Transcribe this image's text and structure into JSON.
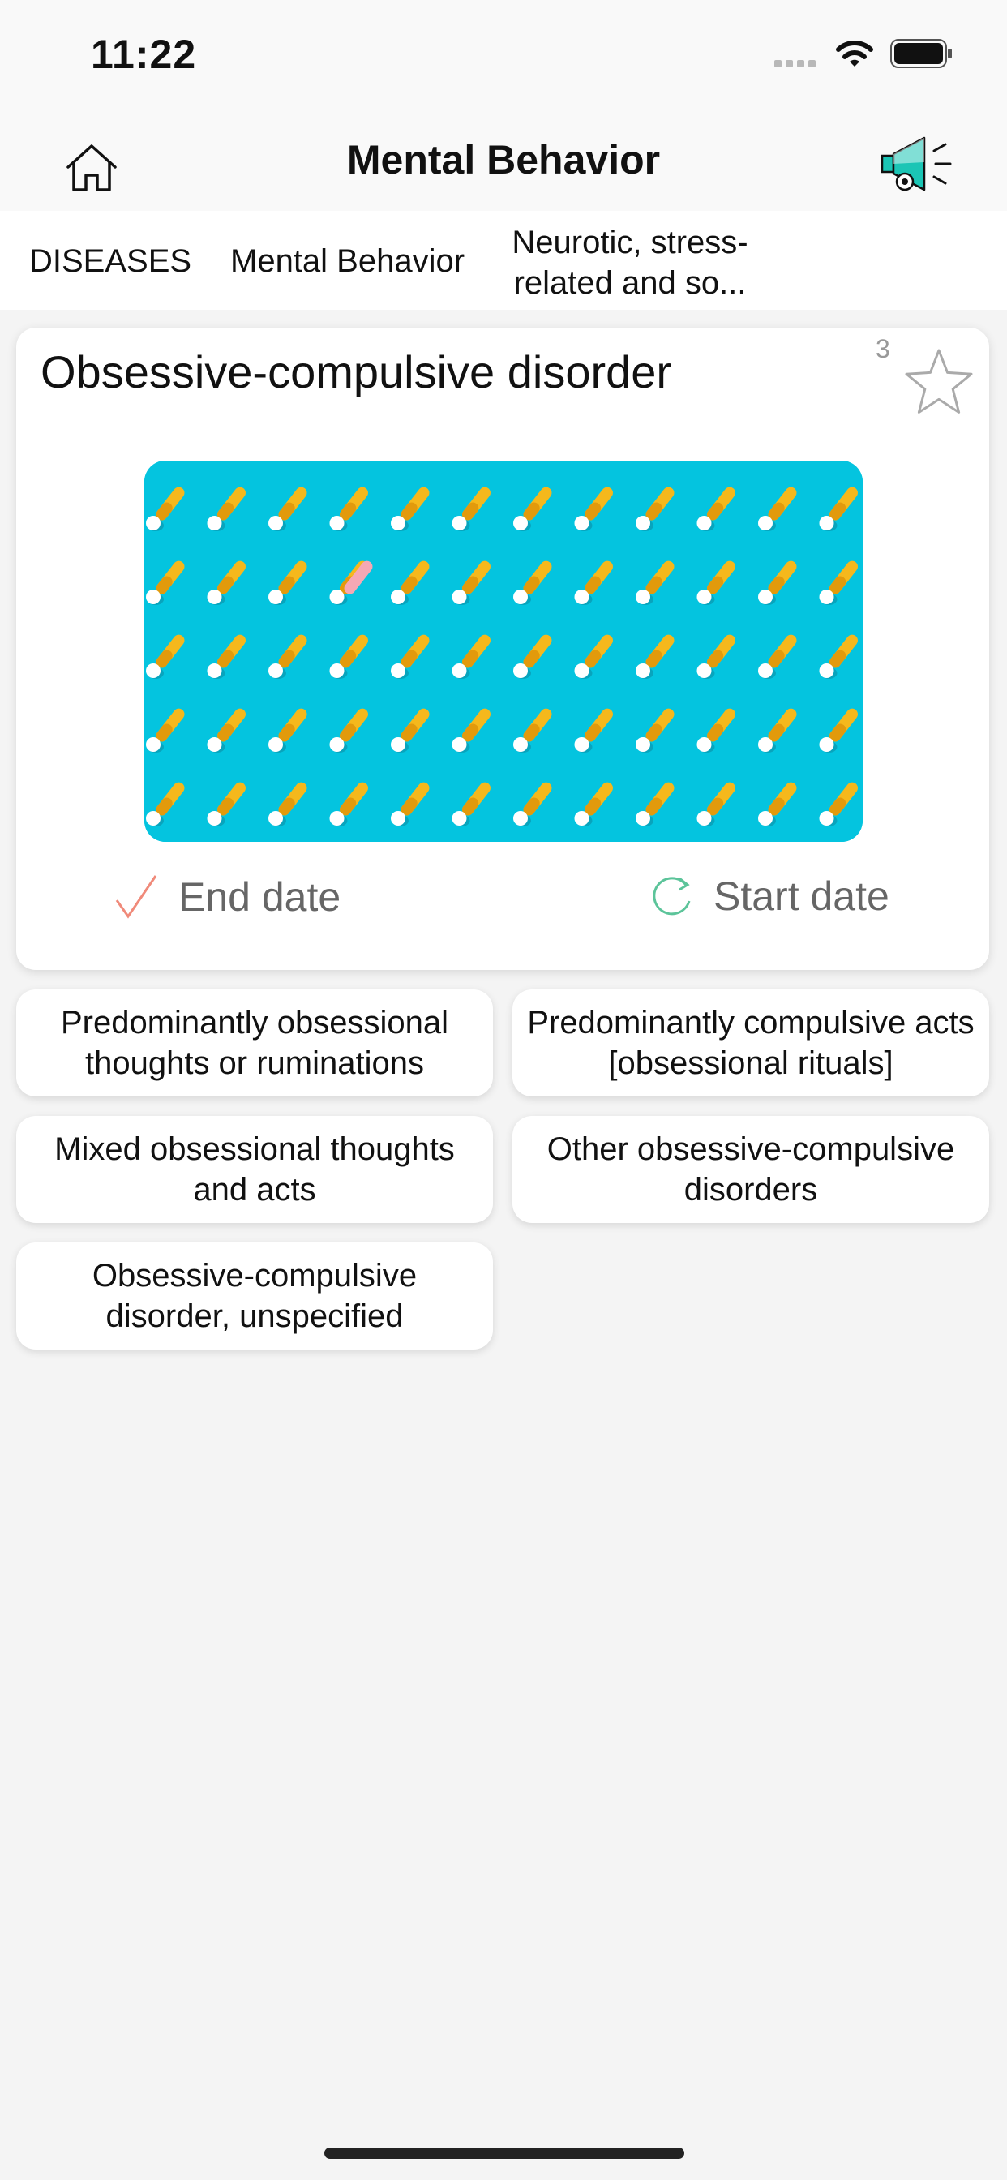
{
  "status_bar": {
    "time": "11:22"
  },
  "header": {
    "title": "Mental Behavior",
    "home_icon": "home-icon",
    "action_icon": "megaphone-icon"
  },
  "breadcrumb": {
    "items": [
      {
        "label": "DISEASES"
      },
      {
        "label": "Mental Behavior"
      },
      {
        "label": "Neurotic, stress-related and so..."
      }
    ]
  },
  "card": {
    "title": "Obsessive-compulsive disorder",
    "count": "3",
    "end_date_label": "End date",
    "start_date_label": "Start date",
    "image_colors": {
      "background": "#04c4df",
      "pill": "#f5b81c",
      "odd_pill": "#f6a8b4"
    }
  },
  "options": [
    {
      "label": "Predominantly obsessional thoughts or ruminations"
    },
    {
      "label": "Predominantly compulsive acts [obsessional rituals]"
    },
    {
      "label": "Mixed obsessional thoughts and acts"
    },
    {
      "label": "Other obsessive-compulsive disorders"
    },
    {
      "label": "Obsessive-compulsive disorder, unspecified"
    }
  ],
  "colors": {
    "accent_check": "#f08a7a",
    "accent_refresh": "#5cc49a",
    "background": "#f4f4f4"
  }
}
